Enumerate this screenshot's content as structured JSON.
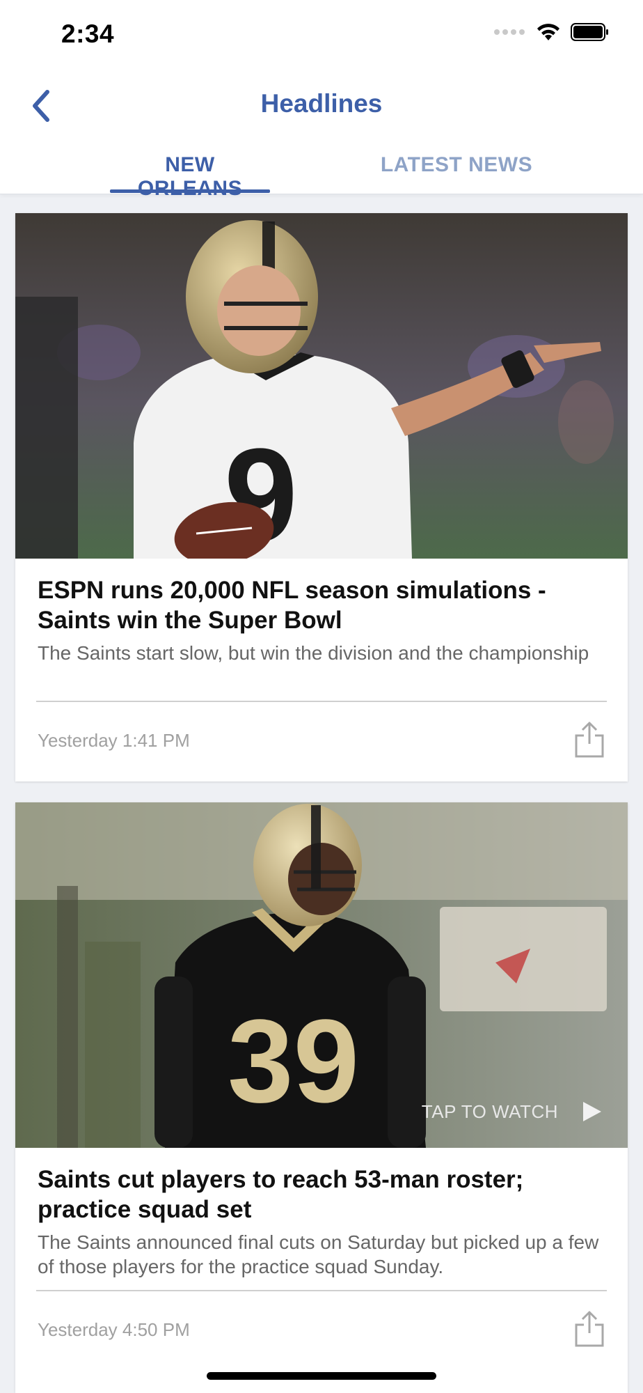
{
  "status_bar": {
    "time": "2:34"
  },
  "header": {
    "title": "Headlines",
    "tabs": [
      {
        "label": "NEW ORLEANS",
        "active": true
      },
      {
        "label": "LATEST NEWS",
        "active": false
      }
    ]
  },
  "articles": [
    {
      "headline": "ESPN runs 20,000 NFL season simulations - Saints win the Super Bowl",
      "summary": "The Saints start slow, but win the division and the championship",
      "timestamp": "Yesterday 1:41 PM",
      "has_video": false
    },
    {
      "headline": "Saints cut players to reach 53-man roster; practice squad set",
      "summary": "The Saints announced final cuts on Saturday but picked up a few of those players for the practice squad Sunday.",
      "timestamp": "Yesterday 4:50 PM",
      "has_video": true,
      "video_label": "TAP TO WATCH"
    }
  ],
  "colors": {
    "accent": "#3d5fa8",
    "inactive_tab": "#8ea3c7",
    "background": "#eef0f4"
  },
  "icons": {
    "back": "chevron-left-icon",
    "share": "share-icon",
    "play": "play-icon",
    "wifi": "wifi-icon",
    "battery": "battery-icon",
    "signal": "cellular-signal-icon"
  }
}
